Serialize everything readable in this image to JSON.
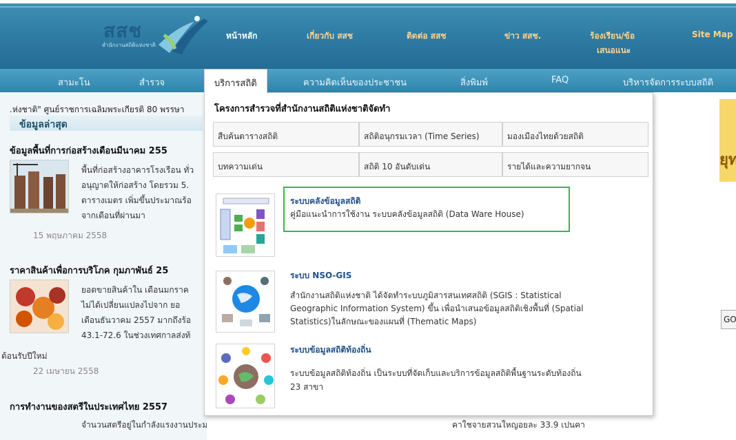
{
  "logo": {
    "text": "สสช",
    "subtitle": "สำนักงานสถิติแห่งชาติ"
  },
  "topnav": [
    {
      "label": "หน้าหลัก"
    },
    {
      "label": "เกี่ยวกับ สสช"
    },
    {
      "label": "ติดต่อ สสช"
    },
    {
      "label": "ข่าว สสช."
    },
    {
      "label": "ร้องเรียน/ข้อ"
    },
    {
      "label": "เสนอแนะ"
    },
    {
      "label": "Site Map"
    }
  ],
  "subnav": [
    {
      "label": "สามะโน"
    },
    {
      "label": "สำรวจ"
    },
    {
      "label": "บริการสถิติ"
    },
    {
      "label": "ความคิดเห็นของประชาชน"
    },
    {
      "label": "สิ่งพิมพ์"
    },
    {
      "label": "FAQ"
    },
    {
      "label": "บริหารจัดการระบบสถิติ"
    }
  ],
  "left": {
    "ticker": ".ห่งชาติ\" ศูนย์ราชการเฉลิมพระเกียรติ 80 พรรษา",
    "section_title": "ข้อมูลล่าสุด",
    "news": [
      {
        "title": "ข้อมูลพื้นที่การก่อสร้างเดือนมีนาคม 255",
        "lines": [
          "พื้นที่ก่อสร้างอาคารโรงเรือน ทั่ว",
          "อนุญาตให้ก่อสร้าง โดยรวม 5.",
          "ตารางเมตร เพิ่มขึ้นประมาณร้อ",
          "จากเดือนที่ผ่านมา"
        ],
        "date": "15 พฤษภาคม 2558"
      },
      {
        "title": "ราคาสินค้าเพื่อการบริโภค กุมภาพันธ์ 25",
        "lines": [
          "ยอดขายสินค้าใน เดือนมกราค",
          "ไม่ได้เปลี่ยนแปลงไปจาก ยอ",
          "เดือนธันวาคม 2557 มากถึงร้อ",
          "43.1-72.6 ในช่วงเทศกาลส่งท้"
        ],
        "extra": "ต้อนรับปีใหม่",
        "date": "22 เมษายน 2558"
      },
      {
        "title": "การทำงานของสตรีในประเทศไทย 2557",
        "lines": [
          "จำนวนสตรีอยู่ในกำลังแรงงานประมาณ"
        ]
      }
    ]
  },
  "dropdown": {
    "title": "โครงการสำรวจที่สำนักงานสถิติแห่งชาติจัดทำ",
    "grid": [
      {
        "label": "สืบค้นตารางสถิติ"
      },
      {
        "label": "สถิติอนุกรมเวลา (Time Series)"
      },
      {
        "label": "มองเมืองไทยด้วยสถิติ"
      },
      {
        "label": "บทความเด่น"
      },
      {
        "label": "สถิติ 10 อันดับเด่น"
      },
      {
        "label": "รายได้และความยากจน"
      }
    ],
    "services": [
      {
        "title": "ระบบคลังข้อมูลสถิติ",
        "desc": [
          "คู่มือแนะนำการใช้งาน ระบบคลังข้อมูลสถิติ (Data Ware House)"
        ]
      },
      {
        "title": "ระบบ NSO-GIS",
        "desc": [
          "สำนักงานสถิติแห่งชาติ ได้จัดทำระบบภูมิสารสนเทศสถิติ (SGIS : Statistical",
          "Geographic Information System) ขึ้น เพื่อนำเสนอข้อมูลสถิติเชิงพื้นที่ (Spatial",
          "Statistics)ในลักษณะของแผนที่ (Thematic Maps)"
        ]
      },
      {
        "title": "ระบบข้อมูลสถิติท้องถิ่น",
        "desc": [
          "ระบบข้อมูลสถิติท้องถิ่น เป็นระบบที่จัดเก็บและบริการข้อมูลสถิติพื้นฐานระดับท้องถิ่น",
          "23 สาขา"
        ]
      }
    ],
    "behind_text": "คาใชจายสวนใหญอยละ 33.9 เปนคา"
  },
  "right": {
    "banner_glyph": "ยุท",
    "go_label": "GO"
  },
  "colors": {
    "header": "#2d7aa3",
    "subnav": "#3a90b8",
    "highlight": "#3cb44b",
    "link": "#1e4f8a"
  }
}
